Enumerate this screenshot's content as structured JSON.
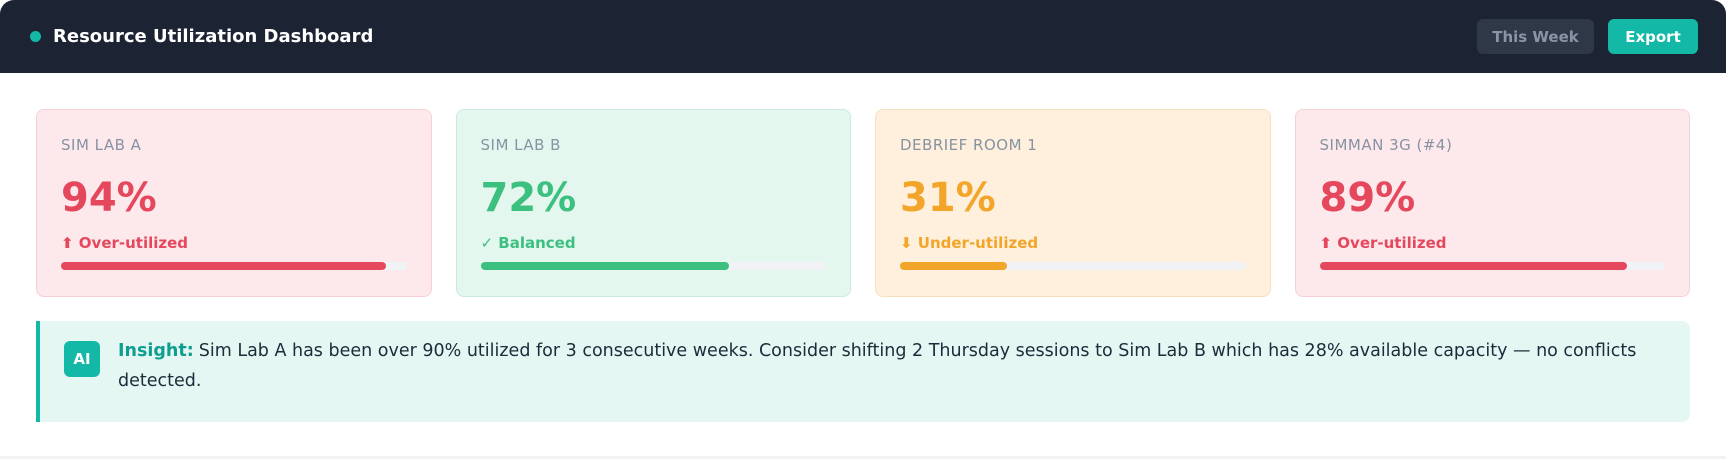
{
  "header": {
    "title": "Resource Utilization Dashboard",
    "period_label": "This Week",
    "export_label": "Export"
  },
  "cards": [
    {
      "label": "SIM LAB A",
      "value": "94%",
      "status": "⬆ Over-utilized",
      "fill": 0.94,
      "tone": "red"
    },
    {
      "label": "SIM LAB B",
      "value": "72%",
      "status": "✓ Balanced",
      "fill": 0.72,
      "tone": "green"
    },
    {
      "label": "DEBRIEF ROOM 1",
      "value": "31%",
      "status": "⬇ Under-utilized",
      "fill": 0.31,
      "tone": "orange"
    },
    {
      "label": "SIMMAN 3G (#4)",
      "value": "89%",
      "status": "⬆ Over-utilized",
      "fill": 0.89,
      "tone": "red"
    }
  ],
  "insight": {
    "badge": "AI",
    "label": "Insight:",
    "text": "Sim Lab A has been over 90% utilized for 3 consecutive weeks. Consider shifting 2 Thursday sessions to Sim Lab B which has 28% available capacity — no conflicts detected."
  },
  "colors": {
    "header_bg": "#1c2434",
    "accent": "#14b8a6",
    "over": "#e5485c",
    "balanced": "#3cc07f",
    "under": "#f3a52a"
  }
}
